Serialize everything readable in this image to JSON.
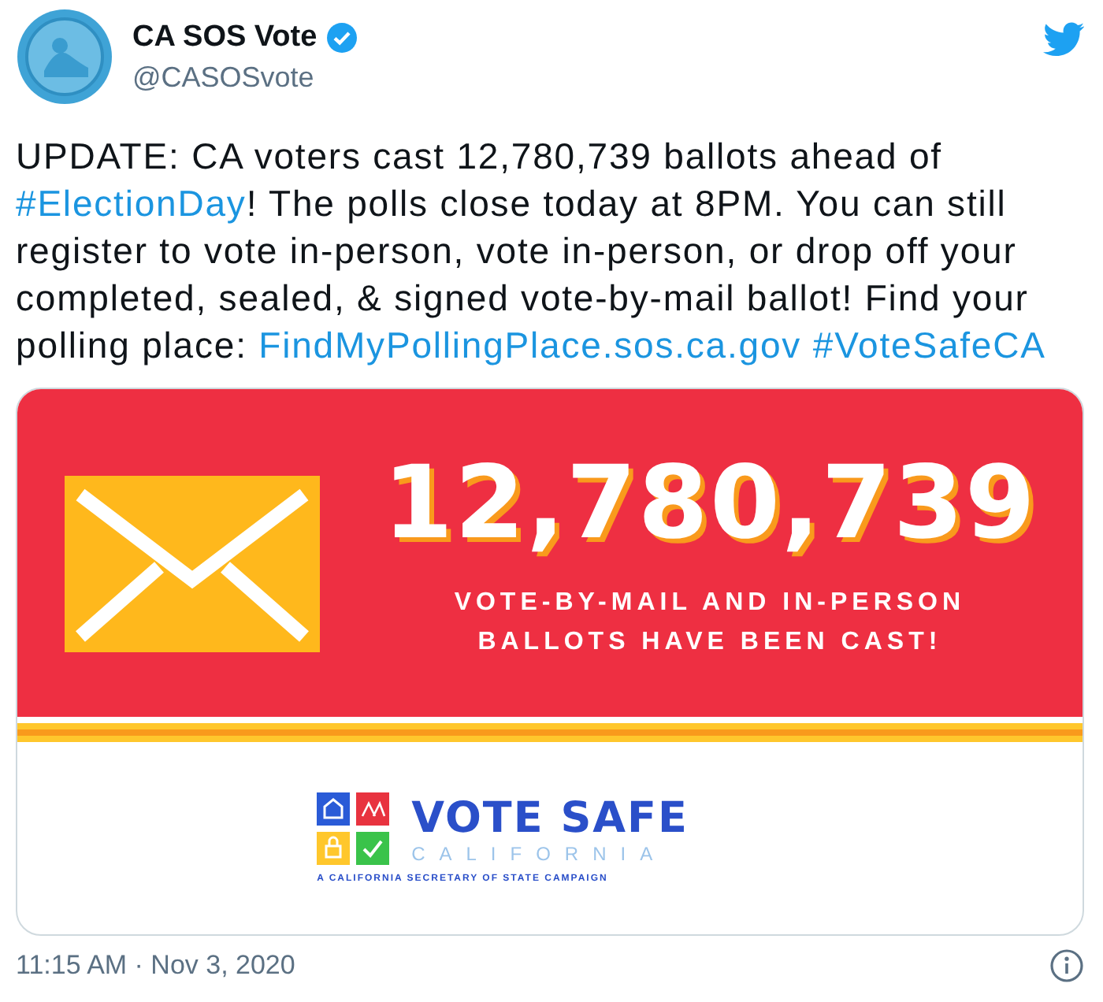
{
  "author": {
    "name": "CA SOS Vote",
    "verified": true,
    "handle": "@CASOSvote"
  },
  "text": [
    {
      "kind": "text",
      "text": "UPDATE: CA voters cast 12,780,739 ballots ahead of "
    },
    {
      "kind": "link",
      "text": "#ElectionDay"
    },
    {
      "kind": "text",
      "text": "! The polls close today at 8PM. You can still register to vote in-person, vote in-person, or drop off your completed, sealed, & signed vote-by-mail ballot! Find your polling place: "
    },
    {
      "kind": "link",
      "text": "FindMyPollingPlace.sos.ca.gov"
    },
    {
      "kind": "link",
      "text": "#VoteSafeCA"
    }
  ],
  "card": {
    "count": "12,780,739",
    "caption_lines": [
      "VOTE-BY-MAIL AND IN-PERSON",
      "BALLOTS HAVE BEEN CAST!"
    ],
    "logo": {
      "title": "VOTE SAFE",
      "subtitle": "CALIFORNIA",
      "tagline": "A CALIFORNIA SECRETARY OF STATE CAMPAIGN"
    }
  },
  "timestamp": "11:15 AM · Nov 3, 2020"
}
